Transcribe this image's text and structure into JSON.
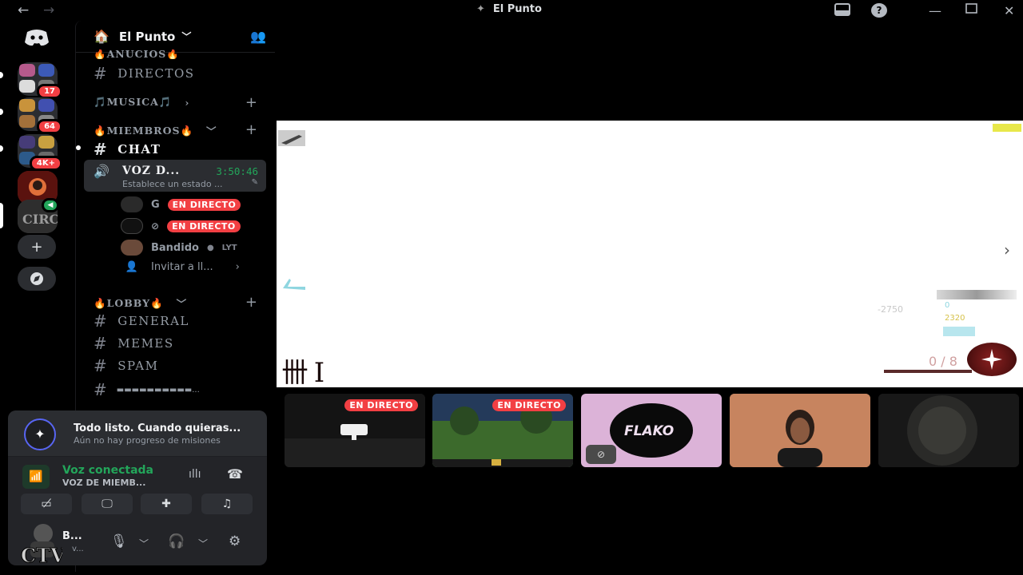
{
  "window": {
    "title": "El Punto",
    "back": "←",
    "forward": "→"
  },
  "rail": {
    "badges": [
      "17",
      "64",
      "4K+"
    ]
  },
  "server": {
    "name": "El Punto"
  },
  "channels": {
    "partial_category": "🔥ANUCIOS🔥",
    "directos": "DIRECTOS",
    "musica_category": "🎵MUSICA🎵",
    "miembros_category": "🔥MIEMBROS🔥",
    "chat": "CHAT",
    "voice": {
      "name": "VOZ D...",
      "timer": "3:50:46",
      "status": "Establece un estado ..."
    },
    "voice_users": [
      {
        "name": "G",
        "tag": "EN DIRECTO"
      },
      {
        "name": "",
        "tag": "EN DIRECTO"
      },
      {
        "name": "Bandido",
        "tag": "LYT"
      }
    ],
    "invite": "Invitar a ll...",
    "lobby_category": "🔥LOBBY🔥",
    "general": "GENERAL",
    "memes": "MEMES",
    "spam": "SPAM",
    "last": "▬▬▬▬▬▬▬▬▬▬..."
  },
  "quest": {
    "title": "Todo listo. Cuando quieras...",
    "subtitle": "Aún no hay progreso de misiones"
  },
  "voice_panel": {
    "status": "Voz conectada",
    "channel": "VOZ DE MIEMB..."
  },
  "user": {
    "name": "B...",
    "sub": "v..."
  },
  "stream": {
    "hud_numbers": [
      "-2750",
      "0",
      "2320"
    ],
    "score": "0 / 8",
    "tally": "卌 I"
  },
  "tiles": [
    {
      "tag": "EN DIRECTO",
      "color": "#1c1c1c"
    },
    {
      "tag": "EN DIRECTO",
      "color": "#2e4a2a"
    },
    {
      "label": "FLAKO",
      "color": "#dcb3d8"
    },
    {
      "label": "",
      "color": "#c7845f"
    },
    {
      "label": "",
      "color": "#1a1a1a"
    }
  ],
  "colors": {
    "live": "#f23f43",
    "voice_green": "#23a55a",
    "accent": "#5865f2"
  }
}
